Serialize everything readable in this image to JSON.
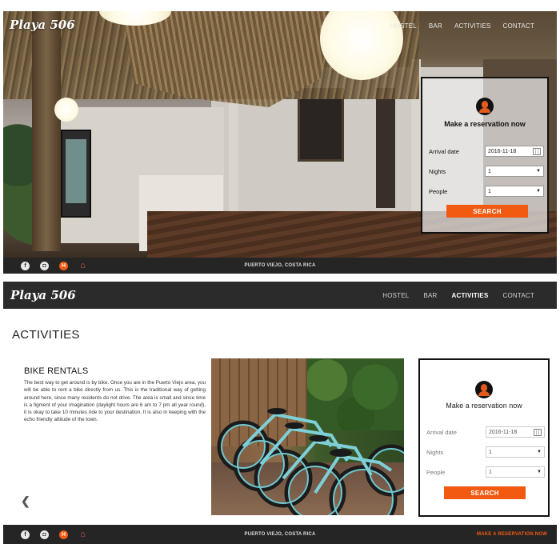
{
  "brand": {
    "logo": "Playa 506"
  },
  "nav": {
    "items": [
      {
        "label": "HOSTEL"
      },
      {
        "label": "BAR"
      },
      {
        "label": "ACTIVITIES"
      },
      {
        "label": "CONTACT"
      }
    ],
    "active": "ACTIVITIES"
  },
  "reservation": {
    "title": "Make a reservation now",
    "arrival_label": "Arrival date",
    "arrival_value": "2016-11-18",
    "nights_label": "Nights",
    "nights_value": "1",
    "people_label": "People",
    "people_value": "1",
    "search_label": "SEARCH"
  },
  "footer": {
    "location": "PUERTO VIEJO, COSTA RICA",
    "cta": "MAKE A RESERVATION NOW",
    "social": [
      {
        "icon": "facebook-icon",
        "glyph": "f"
      },
      {
        "icon": "instagram-icon",
        "glyph": "◘"
      },
      {
        "icon": "hostelworld-icon",
        "glyph": "H"
      },
      {
        "icon": "airbnb-icon",
        "glyph": "⌂"
      }
    ]
  },
  "activities": {
    "page_title": "ACTIVITIES",
    "section_title": "BIKE RENTALS",
    "body": "The best way to get around is by bike. Once you are in the Puerto Viejo area, you will be able to rent a bike directly from us. This is the traditional way of getting around here, since many residents do not drive. The area is small and since time is a figment of your imagination (daylight hours are 6 am to 7 pm all year round), it is okay to take 10 minutes ride to your destination. It is also in keeping with the echo friendly attitude of the town."
  },
  "colors": {
    "accent": "#f25a12",
    "dark_bar": "#252525"
  }
}
